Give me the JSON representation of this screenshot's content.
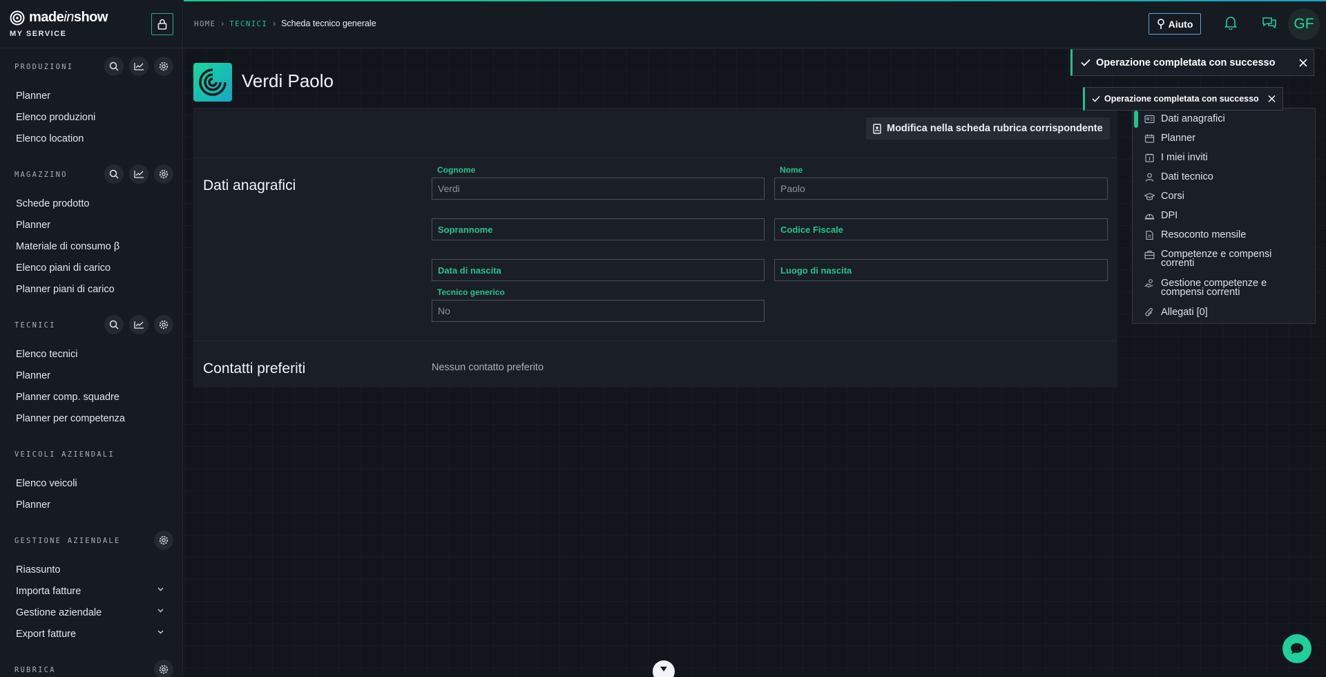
{
  "brand": {
    "name_made": "made",
    "name_in": "in",
    "name_show": "show",
    "subtitle": "MY SERVICE"
  },
  "sidebar": {
    "sections": [
      {
        "title": "PRODUZIONI",
        "items": [
          "Planner",
          "Elenco produzioni",
          "Elenco location"
        ]
      },
      {
        "title": "MAGAZZINO",
        "items": [
          "Schede prodotto",
          "Planner",
          "Materiale di consumo β",
          "Elenco piani di carico",
          "Planner piani di carico"
        ]
      },
      {
        "title": "TECNICI",
        "items": [
          "Elenco tecnici",
          "Planner",
          "Planner comp. squadre",
          "Planner per competenza"
        ]
      },
      {
        "title": "VEICOLI AZIENDALI",
        "items": [
          "Elenco veicoli",
          "Planner"
        ]
      },
      {
        "title": "GESTIONE AZIENDALE",
        "items": [
          "Riassunto",
          "Importa fatture",
          "Gestione aziendale",
          "Export fatture"
        ]
      },
      {
        "title": "RUBRICA",
        "items": []
      }
    ]
  },
  "breadcrumb": {
    "home": "HOME",
    "tecnici": "TECNICI",
    "current": "Scheda tecnico generale"
  },
  "header": {
    "help_label": "Aiuto",
    "avatar_initials": "GF"
  },
  "person": {
    "name": "Verdi Paolo"
  },
  "actions": {
    "edit_label": "Modifica nella scheda rubrica corrispondente"
  },
  "dati_anagrafici": {
    "title": "Dati anagrafici",
    "cognome_label": "Cognome",
    "cognome_value": "Verdi",
    "nome_label": "Nome",
    "nome_value": "Paolo",
    "soprannome_label": "Soprannome",
    "codice_fiscale_label": "Codice Fiscale",
    "data_nascita_label": "Data di nascita",
    "luogo_nascita_label": "Luogo di nascita",
    "tecnico_generico_label": "Tecnico generico",
    "tecnico_generico_value": "No"
  },
  "contatti": {
    "title": "Contatti preferiti",
    "empty": "Nessun contatto preferito"
  },
  "anchor_nav": [
    {
      "label": "Dati anagrafici",
      "icon": "id-card-icon"
    },
    {
      "label": "Planner",
      "icon": "calendar-icon"
    },
    {
      "label": "I miei inviti",
      "icon": "invite-icon"
    },
    {
      "label": "Dati tecnico",
      "icon": "user-icon"
    },
    {
      "label": "Corsi",
      "icon": "graduation-cap-icon"
    },
    {
      "label": "DPI",
      "icon": "helmet-icon"
    },
    {
      "label": "Resoconto mensile",
      "icon": "document-icon"
    },
    {
      "label": "Competenze e compensi correnti",
      "icon": "briefcase-icon"
    },
    {
      "label": "Gestione competenze e compensi correnti",
      "icon": "hand-coins-icon"
    },
    {
      "label": "Allegati [0]",
      "icon": "paperclip-icon"
    }
  ],
  "toasts": [
    "Operazione completata con successo",
    "Operazione completata con successo"
  ],
  "colors": {
    "accent": "#1fc486",
    "background": "#12151c",
    "panel": "#1a1e26"
  }
}
